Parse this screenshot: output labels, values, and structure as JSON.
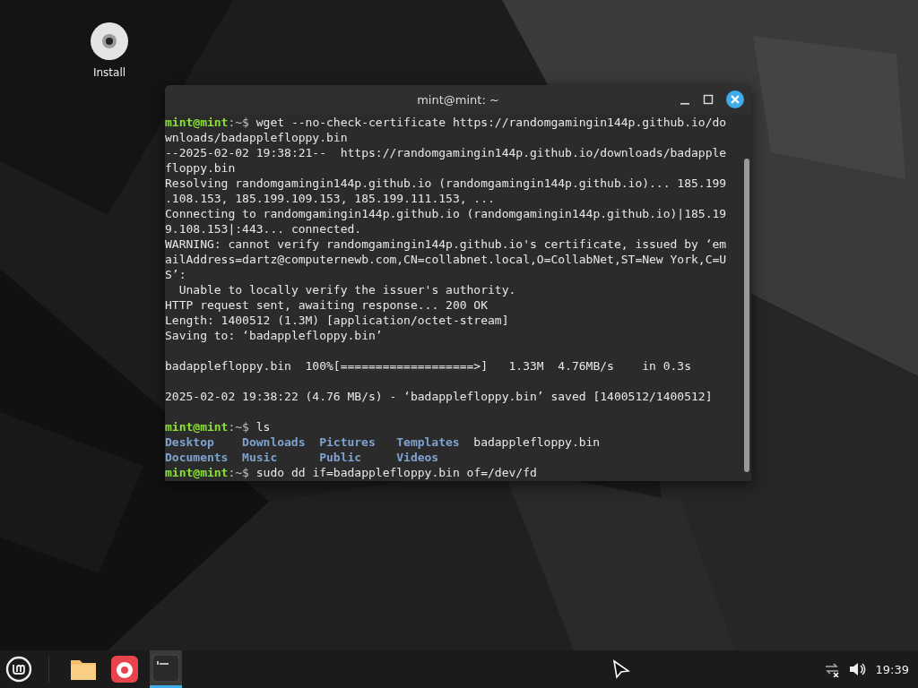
{
  "desktop_icons": [
    {
      "label": "Install"
    }
  ],
  "terminal": {
    "title": "mint@mint: ~",
    "lines": [
      {
        "kind": "prompt",
        "user": "mint@mint",
        "path": ":~$",
        "command": " wget --no-check-certificate https://randomgamingin144p.github.io/do"
      },
      {
        "kind": "output",
        "text": "wnloads/badapplefloppy.bin"
      },
      {
        "kind": "output",
        "text": "--2025-02-02 19:38:21--  https://randomgamingin144p.github.io/downloads/badapple"
      },
      {
        "kind": "output",
        "text": "floppy.bin"
      },
      {
        "kind": "output",
        "text": "Resolving randomgamingin144p.github.io (randomgamingin144p.github.io)... 185.199"
      },
      {
        "kind": "output",
        "text": ".108.153, 185.199.109.153, 185.199.111.153, ..."
      },
      {
        "kind": "output",
        "text": "Connecting to randomgamingin144p.github.io (randomgamingin144p.github.io)|185.19"
      },
      {
        "kind": "output",
        "text": "9.108.153|:443... connected."
      },
      {
        "kind": "output",
        "text": "WARNING: cannot verify randomgamingin144p.github.io's certificate, issued by ‘em"
      },
      {
        "kind": "output",
        "text": "ailAddress=dartz@computernewb.com,CN=collabnet.local,O=CollabNet,ST=New York,C=U"
      },
      {
        "kind": "output",
        "text": "S’:"
      },
      {
        "kind": "output",
        "text": "  Unable to locally verify the issuer's authority."
      },
      {
        "kind": "output",
        "text": "HTTP request sent, awaiting response... 200 OK"
      },
      {
        "kind": "output",
        "text": "Length: 1400512 (1.3M) [application/octet-stream]"
      },
      {
        "kind": "output",
        "text": "Saving to: ‘badapplefloppy.bin’"
      },
      {
        "kind": "blank"
      },
      {
        "kind": "output",
        "text": "badapplefloppy.bin  100%[===================>]   1.33M  4.76MB/s    in 0.3s"
      },
      {
        "kind": "blank"
      },
      {
        "kind": "output",
        "text": "2025-02-02 19:38:22 (4.76 MB/s) - ‘badapplefloppy.bin’ saved [1400512/1400512]"
      },
      {
        "kind": "blank"
      },
      {
        "kind": "prompt",
        "user": "mint@mint",
        "path": ":~$",
        "command": " ls"
      },
      {
        "kind": "listing",
        "items": [
          {
            "kind": "dir",
            "text": "Desktop"
          },
          {
            "kind": "dir",
            "text": "Downloads"
          },
          {
            "kind": "dir",
            "text": "Pictures"
          },
          {
            "kind": "dir",
            "text": "Templates"
          },
          {
            "kind": "file",
            "text": "badapplefloppy.bin"
          }
        ]
      },
      {
        "kind": "listing",
        "items": [
          {
            "kind": "dir",
            "text": "Documents"
          },
          {
            "kind": "dir",
            "text": "Music"
          },
          {
            "kind": "dir",
            "text": "Public"
          },
          {
            "kind": "dir",
            "text": "Videos"
          }
        ]
      },
      {
        "kind": "prompt",
        "user": "mint@mint",
        "path": ":~$",
        "command": " sudo dd if=badapplefloppy.bin of=/dev/fd"
      }
    ]
  },
  "taskbar": {
    "apps": [
      {
        "kind": "files",
        "selected": false
      },
      {
        "kind": "browser",
        "selected": false
      },
      {
        "kind": "terminal",
        "selected": true
      }
    ],
    "clock": "19:39"
  }
}
